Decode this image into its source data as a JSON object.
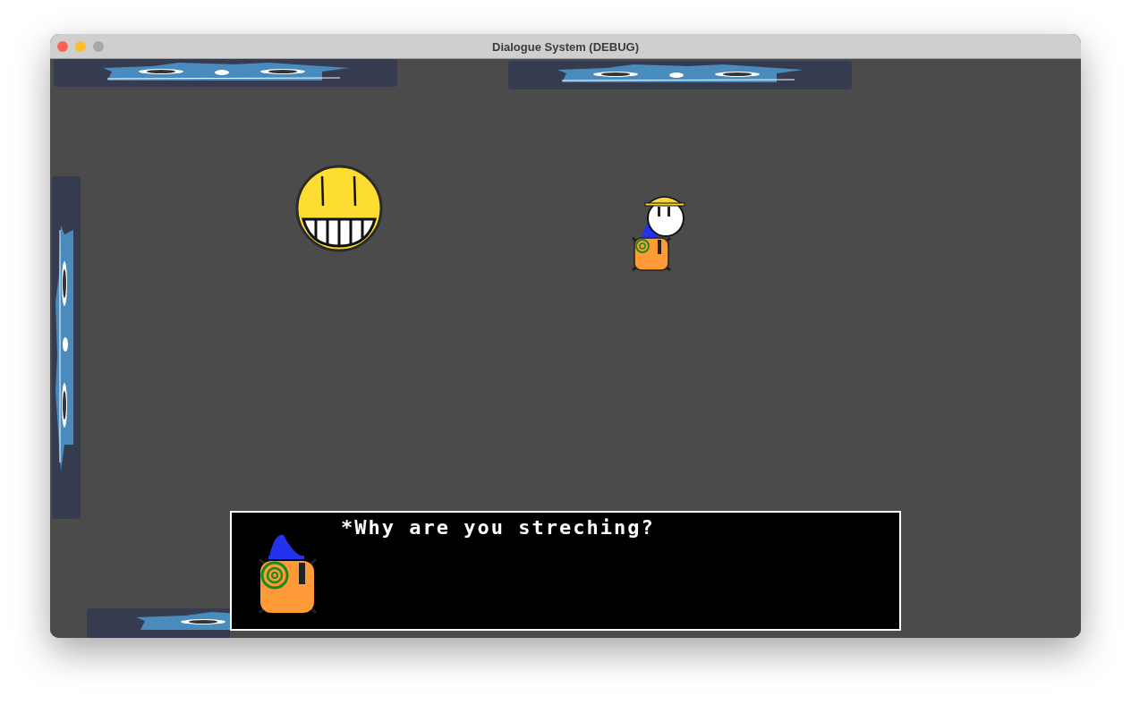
{
  "window": {
    "title": "Dialogue System (DEBUG)"
  },
  "dialogue": {
    "text": "*Why are you streching?"
  }
}
